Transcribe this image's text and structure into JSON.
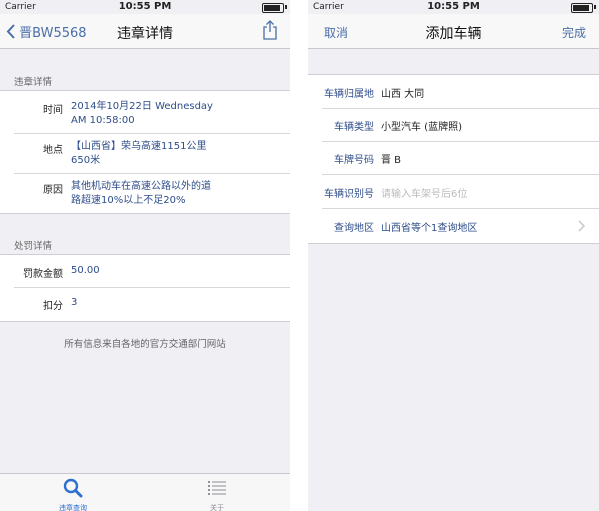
{
  "left": {
    "status": {
      "carrier": "Carrier",
      "time": "10:55 PM"
    },
    "nav": {
      "back_label": "晋BW5568",
      "title": "违章详情"
    },
    "violation": {
      "section_title": "违章详情",
      "time_label": "时间",
      "time_value": [
        "2014年10月22日 Wednesday",
        "AM 10:58:00"
      ],
      "place_label": "地点",
      "place_value": [
        "【山西省】荣乌高速1151公里",
        "650米"
      ],
      "reason_label": "原因",
      "reason_value": [
        "其他机动车在高速公路以外的道",
        "路超速10%以上不足20%"
      ]
    },
    "penalty": {
      "section_title": "处罚详情",
      "fine_label": "罚款金额",
      "fine_value": "50.00",
      "points_label": "扣分",
      "points_value": "3"
    },
    "footer_note": "所有信息来自各地的官方交通部门网站",
    "tabs": [
      {
        "label": "违章查询",
        "icon": "search-icon",
        "active": true
      },
      {
        "label": "关于",
        "icon": "list-icon",
        "active": false
      }
    ]
  },
  "right": {
    "status": {
      "carrier": "Carrier",
      "time": "10:55 PM"
    },
    "nav": {
      "cancel_label": "取消",
      "title": "添加车辆",
      "done_label": "完成"
    },
    "form": {
      "region_label": "车辆归属地",
      "region_value": "山西 大同",
      "type_label": "车辆类型",
      "type_value": "小型汽车 (蓝牌照)",
      "plate_label": "车牌号码",
      "plate_value": "晋 B",
      "vin_label": "车辆识别号",
      "vin_placeholder": "请输入车架号后6位",
      "area_label": "查询地区",
      "area_value": "山西省等个1查询地区"
    }
  },
  "colors": {
    "accent": "#4a6ea9",
    "value_blue": "#2e4d8a",
    "tab_active": "#2f6fd0",
    "tab_inactive": "#8e8e93"
  }
}
